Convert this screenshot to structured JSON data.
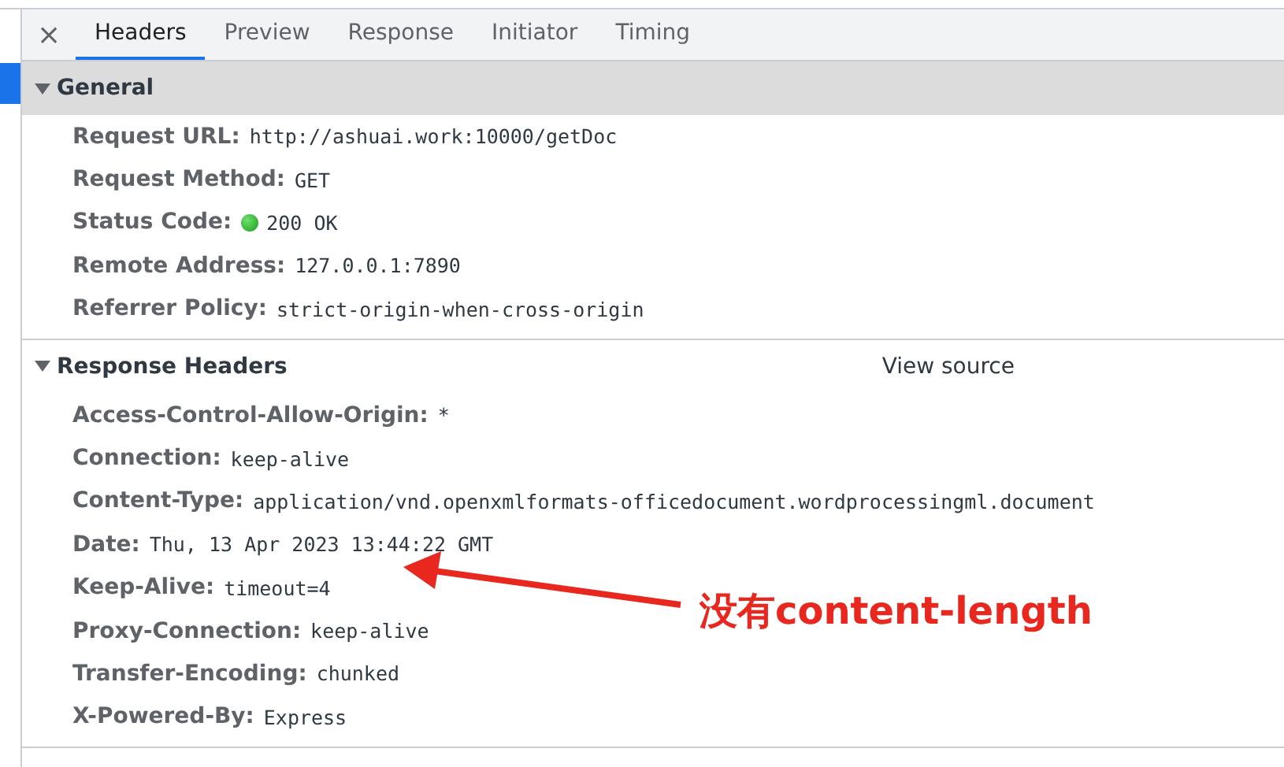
{
  "tabs": [
    {
      "label": "Headers",
      "selected": true
    },
    {
      "label": "Preview",
      "selected": false
    },
    {
      "label": "Response",
      "selected": false
    },
    {
      "label": "Initiator",
      "selected": false
    },
    {
      "label": "Timing",
      "selected": false
    }
  ],
  "close": "×",
  "sections": [
    {
      "title": "General",
      "expanded": true,
      "shaded": true,
      "rows": [
        {
          "name": "Request URL:",
          "value": "http://ashuai.work:10000/getDoc",
          "kind": "plain"
        },
        {
          "name": "Request Method:",
          "value": "GET",
          "kind": "plain"
        },
        {
          "name": "Status Code:",
          "value": "200 OK",
          "kind": "status"
        },
        {
          "name": "Remote Address:",
          "value": "127.0.0.1:7890",
          "kind": "plain"
        },
        {
          "name": "Referrer Policy:",
          "value": "strict-origin-when-cross-origin",
          "kind": "plain"
        }
      ]
    },
    {
      "title": "Response Headers",
      "expanded": true,
      "shaded": false,
      "link": "View source",
      "rows": [
        {
          "name": "Access-Control-Allow-Origin:",
          "value": "*",
          "kind": "plain"
        },
        {
          "name": "Connection:",
          "value": "keep-alive",
          "kind": "plain"
        },
        {
          "name": "Content-Type:",
          "value": "application/vnd.openxmlformats-officedocument.wordprocessingml.document",
          "kind": "plain"
        },
        {
          "name": "Date:",
          "value": "Thu, 13 Apr 2023 13:44:22 GMT",
          "kind": "plain"
        },
        {
          "name": "Keep-Alive:",
          "value": "timeout=4",
          "kind": "plain"
        },
        {
          "name": "Proxy-Connection:",
          "value": "keep-alive",
          "kind": "plain"
        },
        {
          "name": "Transfer-Encoding:",
          "value": "chunked",
          "kind": "plain"
        },
        {
          "name": "X-Powered-By:",
          "value": "Express",
          "kind": "plain"
        }
      ]
    }
  ],
  "annotation": {
    "text": "没有content-length"
  }
}
